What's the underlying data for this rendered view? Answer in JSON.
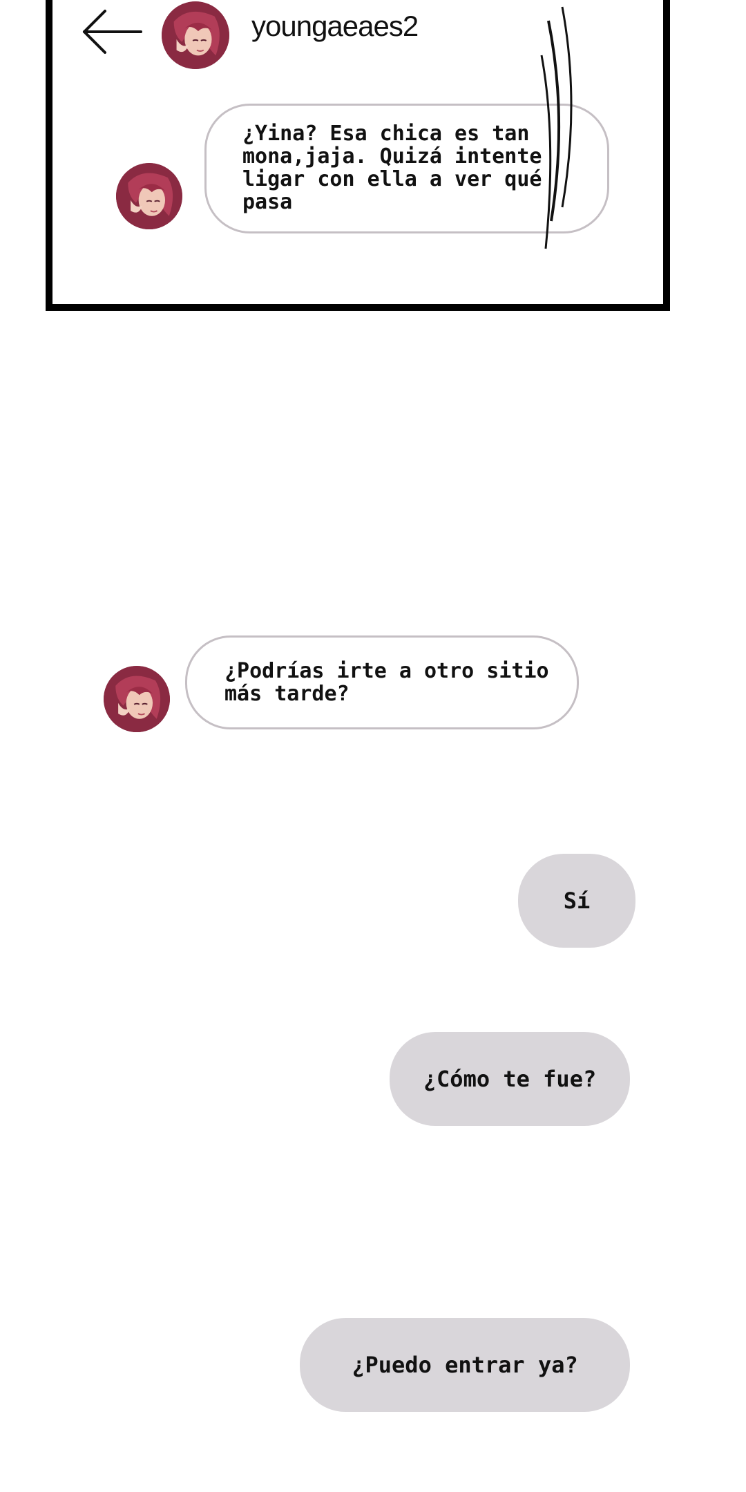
{
  "header": {
    "back_icon": "back-arrow-icon",
    "username": "youngaeaes2",
    "avatar_icon": "avatar-icon"
  },
  "messages": [
    {
      "direction": "incoming",
      "text": "¿Yina? Esa chica es tan\nmona,jaja. Quizá intente\nligar con ella a ver qué\npasa"
    },
    {
      "direction": "incoming",
      "text": "¿Podrías irte a otro sitio\nmás tarde?"
    },
    {
      "direction": "outgoing",
      "text": "Sí"
    },
    {
      "direction": "outgoing",
      "text": "¿Cómo te fue?"
    },
    {
      "direction": "outgoing",
      "text": "¿Puedo entrar ya?"
    }
  ],
  "colors": {
    "outgoing_bubble": "#d9d6da",
    "incoming_border": "#c5bfc4",
    "panel_border": "#000000",
    "avatar_hair": "#9e2f4b"
  }
}
